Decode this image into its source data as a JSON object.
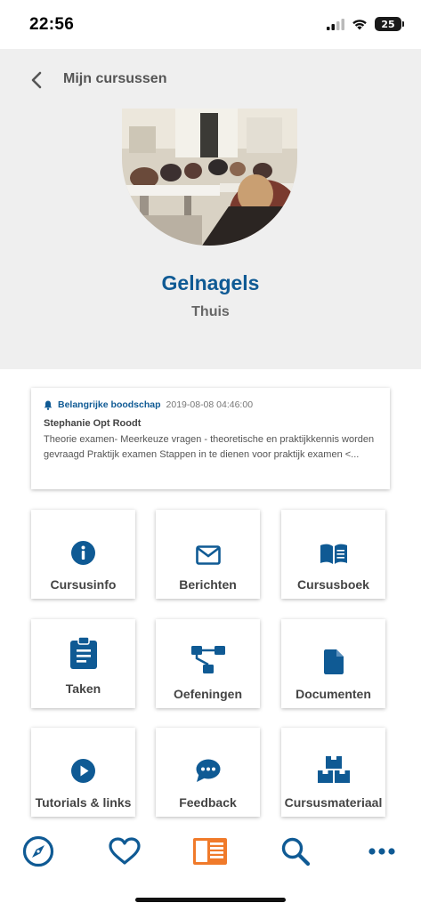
{
  "status_bar": {
    "time": "22:56",
    "battery": "25"
  },
  "header": {
    "back_title": "Mijn cursussen",
    "course_title": "Gelnagels",
    "course_subtitle": "Thuis"
  },
  "announcement": {
    "label": "Belangrijke boodschap",
    "date": "2019-08-08 04:46:00",
    "author": "Stephanie Opt Roodt",
    "text": "Theorie examen- Meerkeuze vragen - theoretische en praktijkkennis worden gevraagd Praktijk examen Stappen in te dienen voor praktijk examen <..."
  },
  "tiles": [
    {
      "label": "Cursusinfo",
      "icon": "info-icon"
    },
    {
      "label": "Berichten",
      "icon": "mail-icon"
    },
    {
      "label": "Cursusboek",
      "icon": "book-icon"
    },
    {
      "label": "Taken",
      "icon": "clipboard-icon"
    },
    {
      "label": "Oefeningen",
      "icon": "hierarchy-icon"
    },
    {
      "label": "Documenten",
      "icon": "document-icon"
    },
    {
      "label": "Tutorials & links",
      "icon": "play-icon"
    },
    {
      "label": "Feedback",
      "icon": "chat-bubble-icon"
    },
    {
      "label": "Cursusmateriaal",
      "icon": "boxes-icon"
    }
  ],
  "bottom_nav": [
    {
      "icon": "compass-icon"
    },
    {
      "icon": "heart-icon"
    },
    {
      "icon": "courses-icon",
      "active": true
    },
    {
      "icon": "search-icon"
    },
    {
      "icon": "more-icon"
    }
  ],
  "colors": {
    "primary": "#0f5a94",
    "active": "#f07a2a",
    "header_bg": "#efefef"
  }
}
